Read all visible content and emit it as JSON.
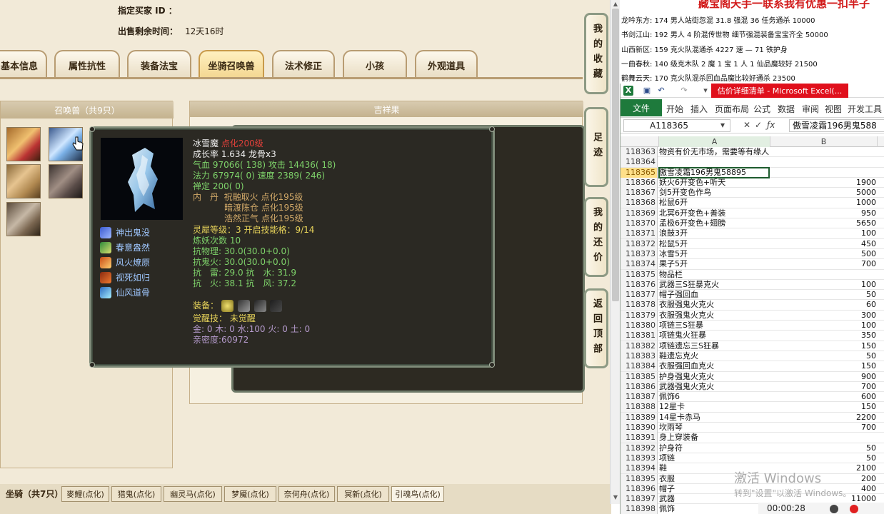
{
  "game": {
    "buyer_label": "指定买家 ID ：",
    "remaining_label": "出售剩余时间：",
    "remaining_value": "12天16时",
    "tabs": [
      {
        "label": "基本信息"
      },
      {
        "label": "属性抗性"
      },
      {
        "label": "装备法宝"
      },
      {
        "label": "坐骑召唤兽",
        "active": true
      },
      {
        "label": "法术修正"
      },
      {
        "label": "小孩"
      },
      {
        "label": "外观道具"
      }
    ],
    "pets_header": "召唤兽（共9只）",
    "fruit_header": "吉祥果",
    "side_buttons": [
      {
        "label": "我的收藏"
      },
      {
        "label": "足迹"
      },
      {
        "label": "我的还价"
      },
      {
        "label": "返回顶部"
      }
    ],
    "mount_label": "坐骑（共7只）",
    "mounts": [
      "麥鯉(点化)",
      "猎鬼(点化)",
      "幽灵马(点化)",
      "梦魇(点化)",
      "奈何舟(点化)",
      "冥新(点化)",
      "引魂鸟(点化)"
    ]
  },
  "popup": {
    "name": "冰雪魔",
    "name_note": "点化200级",
    "growth": "成长率 1.634 龙骨x3",
    "hp_line": [
      "气血 97066( 138)",
      "攻击 14436( 18)"
    ],
    "mp_line": [
      "法力 67974( 0)",
      "速度 2389( 246)"
    ],
    "zen": "禅定 200( 0)",
    "neidan_label": "内　丹",
    "neidan": [
      "祝融取火 点化195级",
      "暗渡陈仓 点化195级",
      "浩然正气 点化195级"
    ],
    "spirit": "灵犀等级：3 开启技能格：9/14",
    "refine": "炼妖次数 10",
    "resist_phys": "抗物理: 30.0(30.0+0.0)",
    "resist_ghost": "抗鬼火: 30.0(30.0+0.0)",
    "resist_line1": "抗　雷: 29.0 抗　水: 31.9",
    "resist_line2": "抗　火: 38.1 抗　风: 37.2",
    "equip_label": "装备：",
    "awaken": "觉醒技： 未觉醒",
    "elements": "金: 0 木: 0 水:100 火: 0 土: 0",
    "intimacy": "亲密度:60972",
    "skills": [
      {
        "name": "神出鬼没"
      },
      {
        "name": "春意盎然"
      },
      {
        "name": "风火燎原"
      },
      {
        "name": "视死如归"
      },
      {
        "name": "仙风道骨"
      }
    ]
  },
  "notes": {
    "title": "藏宝阁天手一联系我有优惠一扣半子",
    "lines": [
      "龙吟东方: 174 男人站街忽混 31.8 强混 36 任务通杀 10000",
      "书剑江山: 192 男人 4 阶混传世物   细节强混装备宝宝齐全 50000",
      "山西新区: 159 克火队混通杀 4227 速 — 71 铁护身",
      "一曲春秋: 140 级克木队 2 魔 1 宝 1 人 1 仙品魔较好 21500",
      "鹤舞云天: 170 克火队混杀回血品魔比较好通杀 23500"
    ]
  },
  "excel": {
    "window_title": "估价详细清单 - Microsoft Excel(...",
    "ribbon_tabs": [
      "文件",
      "开始",
      "插入",
      "页面布局",
      "公式",
      "数据",
      "审阅",
      "视图",
      "开发工具"
    ],
    "name_box": "A118365",
    "formula": "傲雪凌霜196男鬼588",
    "col_headers": [
      "A",
      "B"
    ],
    "rows": [
      {
        "n": "118363",
        "a": "物资有价无市场，需要等有缘人",
        "b": ""
      },
      {
        "n": "118364",
        "a": "",
        "b": ""
      },
      {
        "n": "118365",
        "a": "傲雪凌霜196男鬼58895",
        "b": "",
        "sel": true
      },
      {
        "n": "118366",
        "a": "妖火6开变色+听天",
        "b": "1900"
      },
      {
        "n": "118367",
        "a": "剑5开变色作鸟",
        "b": "5000"
      },
      {
        "n": "118368",
        "a": "松鼠6开",
        "b": "1000"
      },
      {
        "n": "118369",
        "a": "北冥6开变色+善装",
        "b": "950"
      },
      {
        "n": "118370",
        "a": "孟极6开变色+翅膀",
        "b": "5650"
      },
      {
        "n": "118371",
        "a": "浪鼓3开",
        "b": "100"
      },
      {
        "n": "118372",
        "a": "松鼠5开",
        "b": "450"
      },
      {
        "n": "118373",
        "a": "冰雪5开",
        "b": "500"
      },
      {
        "n": "118374",
        "a": "果子5开",
        "b": "700"
      },
      {
        "n": "118375",
        "a": "物品栏",
        "b": ""
      },
      {
        "n": "118376",
        "a": "武器三S狂暴克火",
        "b": "100"
      },
      {
        "n": "118377",
        "a": "帽子强回血",
        "b": "50"
      },
      {
        "n": "118378",
        "a": "衣服强鬼火克火",
        "b": "60"
      },
      {
        "n": "118379",
        "a": "衣服强鬼火克火",
        "b": "300"
      },
      {
        "n": "118380",
        "a": "项链三S狂暴",
        "b": "100"
      },
      {
        "n": "118381",
        "a": "项链鬼火狂暴",
        "b": "350"
      },
      {
        "n": "118382",
        "a": "项链遗忘三S狂暴",
        "b": "150"
      },
      {
        "n": "118383",
        "a": "鞋遗忘克火",
        "b": "50"
      },
      {
        "n": "118384",
        "a": "衣服强回血克火",
        "b": "150"
      },
      {
        "n": "118385",
        "a": "护身强鬼火克火",
        "b": "900"
      },
      {
        "n": "118386",
        "a": "武器强鬼火克火",
        "b": "700"
      },
      {
        "n": "118387",
        "a": "佩饰6",
        "b": "600"
      },
      {
        "n": "118388",
        "a": "12星卡",
        "b": "150"
      },
      {
        "n": "118389",
        "a": "14星卡赤马",
        "b": "2200"
      },
      {
        "n": "118390",
        "a": "坎雨琴",
        "b": "700"
      },
      {
        "n": "118391",
        "a": "身上穿装备",
        "b": ""
      },
      {
        "n": "118392",
        "a": "护身符",
        "b": "50"
      },
      {
        "n": "118393",
        "a": "项链",
        "b": "50"
      },
      {
        "n": "118394",
        "a": "鞋",
        "b": "2100"
      },
      {
        "n": "118395",
        "a": "衣服",
        "b": "200"
      },
      {
        "n": "118396",
        "a": "帽子",
        "b": "400"
      },
      {
        "n": "118397",
        "a": "武器",
        "b": "11000"
      },
      {
        "n": "118398",
        "a": "佩饰",
        "b": ""
      }
    ]
  },
  "overlay": {
    "watermark": "激活 Windows",
    "watermark_sub": "转到\"设置\"以激活 Windows。",
    "rec_time": "00:00:28"
  }
}
